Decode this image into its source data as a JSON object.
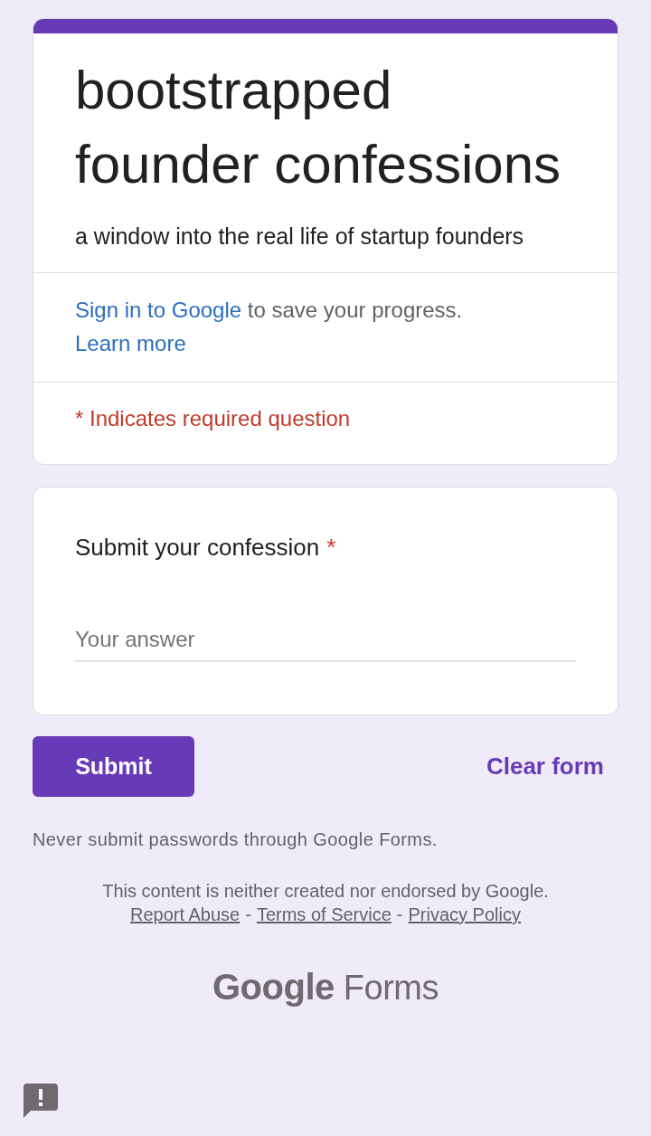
{
  "header": {
    "title": "bootstrapped founder confessions",
    "description": "a window into the real life of startup founders"
  },
  "sign_in": {
    "link": "Sign in to Google",
    "text": " to save your progress.",
    "learn_more": "Learn more"
  },
  "required_notice": "* Indicates required question",
  "question": {
    "title": "Submit your confession",
    "required": true,
    "required_mark": "*",
    "placeholder": "Your answer"
  },
  "actions": {
    "submit": "Submit",
    "clear": "Clear form"
  },
  "footer": {
    "warning": "Never submit passwords through Google Forms.",
    "disclaimer": "This content is neither created nor endorsed by Google.",
    "links": [
      "Report Abuse",
      "Terms of Service",
      "Privacy Policy"
    ],
    "separators": [
      "-",
      "-"
    ],
    "logo": "**Google** Forms"
  }
}
